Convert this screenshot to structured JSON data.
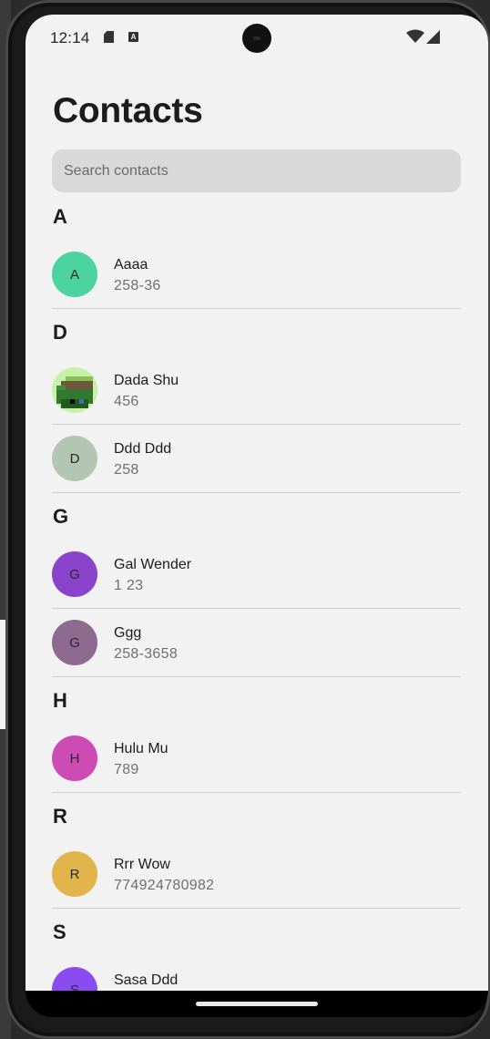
{
  "status_bar": {
    "time": "12:14",
    "a_icon_letter": "A"
  },
  "header": {
    "title": "Contacts"
  },
  "search": {
    "placeholder": "Search contacts",
    "value": ""
  },
  "sections": [
    {
      "letter": "A",
      "contacts": [
        {
          "initial": "A",
          "name": "Aaaa",
          "phone": "258-36",
          "color": "#4dd3a0"
        }
      ]
    },
    {
      "letter": "D",
      "contacts": [
        {
          "initial": "",
          "name": "Dada Shu",
          "phone": "456",
          "color": "#c8f0a8",
          "photo": "pixel-art-photo"
        },
        {
          "initial": "D",
          "name": "Ddd Ddd",
          "phone": "258",
          "color": "#b3c6b3"
        }
      ]
    },
    {
      "letter": "G",
      "contacts": [
        {
          "initial": "G",
          "name": "Gal Wender",
          "phone": "1 23",
          "color": "#8a44cc"
        },
        {
          "initial": "G",
          "name": "Ggg",
          "phone": "258-3658",
          "color": "#8d6a8f"
        }
      ]
    },
    {
      "letter": "H",
      "contacts": [
        {
          "initial": "H",
          "name": "Hulu Mu",
          "phone": "789",
          "color": "#cc4cb4"
        }
      ]
    },
    {
      "letter": "R",
      "contacts": [
        {
          "initial": "R",
          "name": "Rrr Wow",
          "phone": "774924780982",
          "color": "#e2b54c"
        }
      ]
    },
    {
      "letter": "S",
      "contacts": [
        {
          "initial": "S",
          "name": "Sasa Ddd",
          "phone": "",
          "color": "#8a4cf0"
        }
      ]
    }
  ]
}
